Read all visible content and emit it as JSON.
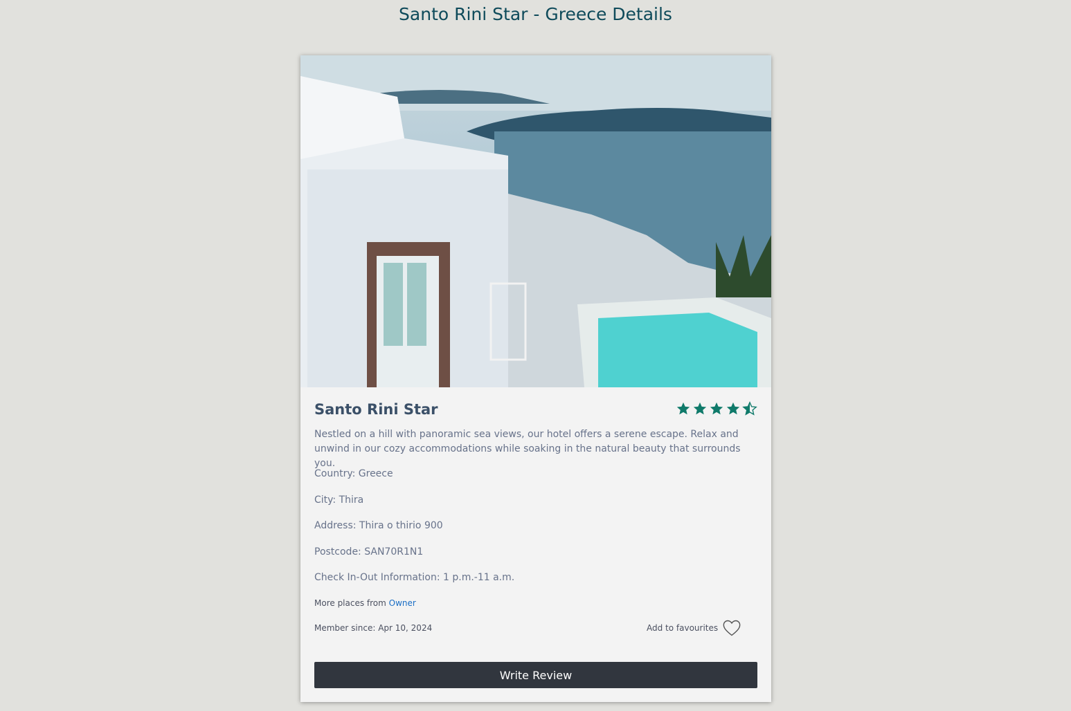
{
  "page": {
    "title": "Santo Rini Star - Greece Details"
  },
  "hotel": {
    "name": "Santo Rini Star",
    "rating": 4.5,
    "rating_max": 5,
    "description": "Nestled on a hill with panoramic sea views, our hotel offers a serene escape. Relax and unwind in our cozy accommodations while soaking in the natural beauty that surrounds you.",
    "country": "Country: Greece",
    "city": "City: Thira",
    "address": "Address: Thira o thirio 900",
    "postcode": "Postcode: SAN70R1N1",
    "checkin": "Check In-Out Information: 1 p.m.-11 a.m.",
    "more_places_prefix": "More places from ",
    "owner_link": "Owner",
    "member_since": "Member since: Apr 10, 2024",
    "add_favourites": "Add to favourites",
    "write_review": "Write Review"
  },
  "colors": {
    "accent_star": "#0f7a6a",
    "title": "#0e4a5a",
    "button_bg": "#31363e",
    "link": "#1a6ec5"
  },
  "icons": {
    "star": "star-icon",
    "half_star": "half-star-icon",
    "heart": "heart-icon"
  }
}
